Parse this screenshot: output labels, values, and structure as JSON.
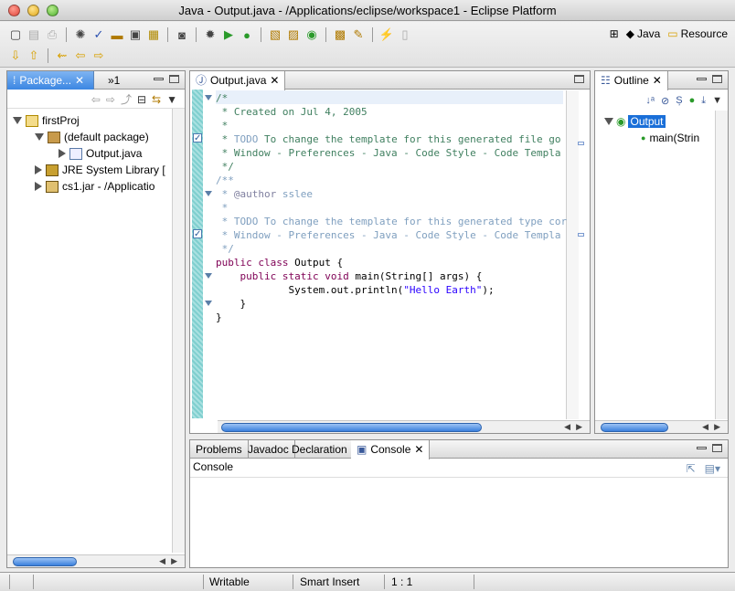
{
  "window": {
    "title": "Java - Output.java - /Applications/eclipse/workspace1 - Eclipse Platform"
  },
  "perspectives": {
    "java": "Java",
    "resource": "Resource"
  },
  "package_explorer": {
    "tab_label": "Package...",
    "other_tab": "»1",
    "tree": {
      "project": "firstProj",
      "default_package": "(default package)",
      "file": "Output.java",
      "jre": "JRE System Library [",
      "jar": "cs1.jar - /Applicatio"
    }
  },
  "editor": {
    "tab_label": "Output.java",
    "lines": {
      "l1": "/*",
      "l2": " * Created on Jul 4, 2005",
      "l3": " *",
      "l4_pre": " * ",
      "l4_todo": "TODO",
      "l4_rest": " To change the template for this generated file go",
      "l5": " * Window - Preferences - Java - Code Style - Code Templa",
      "l6": " */",
      "l7": "",
      "l8": "/**",
      "l9_pre": " * ",
      "l9_tag": "@author",
      "l9_rest": " sslee",
      "l10": " *",
      "l11_pre": " * ",
      "l11_todo": "TODO",
      "l11_rest": " To change the template for this generated type cor",
      "l12": " * Window - Preferences - Java - Code Style - Code Templa",
      "l13": " */",
      "l14_kw": "public class",
      "l14_rest": " Output {",
      "l15": "",
      "l16_kw": "    public static void",
      "l16_rest": " main(String[] args) {",
      "l17_pre": "            System.out.println(",
      "l17_str": "\"Hello Earth\"",
      "l17_post": ");",
      "l18": "    }",
      "l19": "}"
    }
  },
  "outline": {
    "tab_label": "Outline",
    "class_name": "Output",
    "method": "main(Strin"
  },
  "bottom": {
    "tabs": [
      "Problems",
      "Javadoc",
      "Declaration",
      "Console"
    ],
    "console_title": "Console"
  },
  "status": {
    "writable": "Writable",
    "insert_mode": "Smart Insert",
    "position": "1 : 1"
  }
}
